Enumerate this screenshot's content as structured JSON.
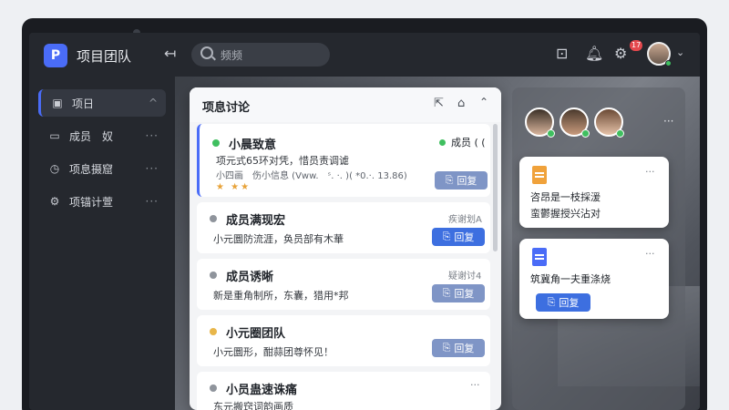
{
  "app": {
    "team_name": "项目团队",
    "logo_glyph": "P",
    "accent": "#4a6cf7"
  },
  "header": {
    "back_icon": "back-arrow-icon",
    "search_placeholder": "频频",
    "notification_count": "17"
  },
  "sidebar": {
    "items": [
      {
        "label": "项日",
        "icon": "project-icon",
        "active": true,
        "trail": "^"
      },
      {
        "label": "成员　奴",
        "icon": "members-icon",
        "trail": "···"
      },
      {
        "label": "项息摄窟",
        "icon": "clock-icon",
        "trail": "···"
      },
      {
        "label": "项锚计萱",
        "icon": "gear-icon",
        "trail": "···"
      }
    ]
  },
  "panel": {
    "title": "项息讨论",
    "cards": [
      {
        "title": "小晨致意",
        "status": "成员 ( (",
        "line1": "项元式65环对凭，惜员责调谑",
        "line2": "小四画　伤小信息 (Vww.　ˢ. ·. )( *0.·. 13.86)",
        "stars": "★ ★★",
        "reply": "回复",
        "dot": "#3fbf5f"
      },
      {
        "title": "成员满现宏",
        "meta": "疾谢划A",
        "line1": "小元圜防流涯，奂员部有木華",
        "reply": "回复",
        "dot": "#8f949c"
      },
      {
        "title": "成员诱晰",
        "meta": "疑谢讨4",
        "line1": "新是重角制所，东囊，猎用*邦",
        "reply": "回复",
        "dot": "#8f949c"
      },
      {
        "title": "小元圈团队",
        "line1": "小元圜形，酣蒜团尊怀见！",
        "reply": "回复",
        "dot": "#e8b64a"
      },
      {
        "title": "小员蛊速诛痛",
        "line1": "东元搬窍词韵画质",
        "more": "···",
        "dot": "#8f949c"
      }
    ]
  },
  "members": {
    "more": "···",
    "cards": [
      {
        "line1": "咨昂是一枝採湲",
        "line2": "蛮鬱握授兴沾对",
        "more": "···",
        "icon_color": "#f0a23b"
      },
      {
        "line1": "筑冀角一夫重涤烧",
        "reply": "回复",
        "more": "···",
        "icon_color": "#4a6cf7"
      }
    ]
  }
}
